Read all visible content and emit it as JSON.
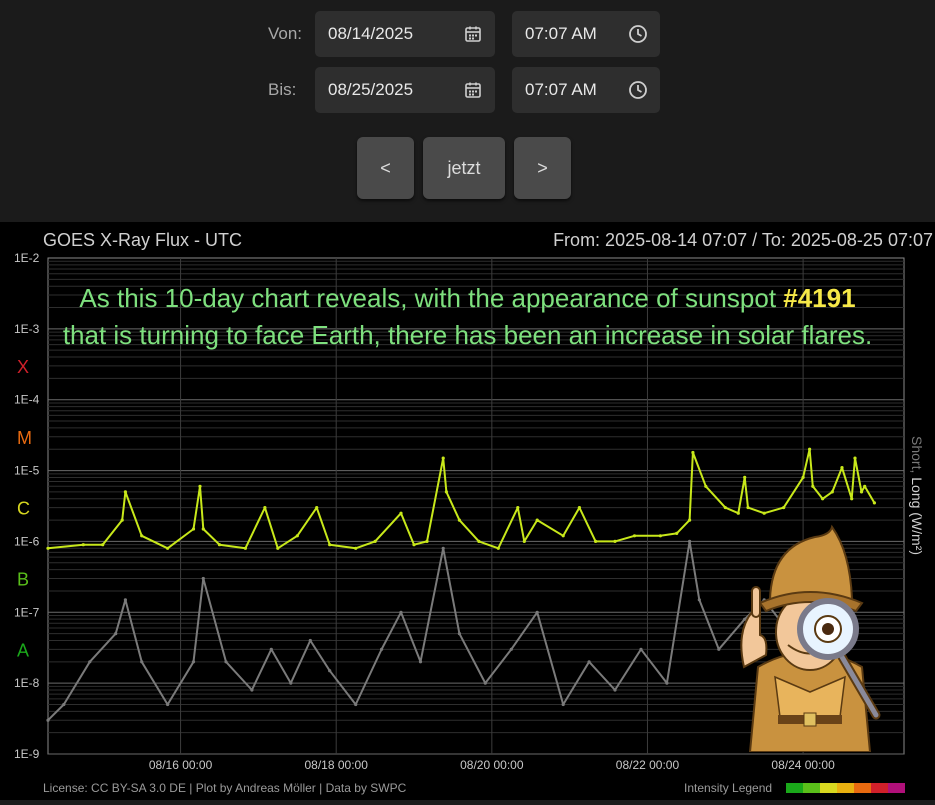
{
  "controls": {
    "from_label": "Von:",
    "from_date": "08/14/2025",
    "from_time": "07:07 AM",
    "to_label": "Bis:",
    "to_date": "08/25/2025",
    "to_time": "07:07 AM",
    "prev_label": "<",
    "now_label": "jetzt",
    "next_label": ">"
  },
  "overlay": {
    "text_before": "As this 10-day chart reveals, with the appearance of sunspot ",
    "highlight": "#4191",
    "text_after": " that is turning to face Earth, there has been an increase in solar flares."
  },
  "colors": {
    "long_series": "#c8e81a",
    "short_series": "#7a7a7a",
    "class_x": "#d0202a",
    "class_m": "#e86a10",
    "class_c": "#d8d820",
    "class_b": "#5abf1a",
    "class_a": "#1aa81a"
  },
  "chart_data": {
    "type": "line",
    "title": "GOES X-Ray Flux - UTC",
    "range_text": "From: 2025-08-14 07:07  /  To: 2025-08-25 07:07",
    "ylabel_short": "Short",
    "ylabel_sep": ", ",
    "ylabel_long": "Long (W/m²)",
    "yscale": "log",
    "ylim": [
      1e-09,
      0.01
    ],
    "xlim": [
      "2025-08-14 07:07",
      "2025-08-25 07:07"
    ],
    "x_ticks": [
      {
        "t": "2025-08-16 00:00",
        "label": "08/16 00:00"
      },
      {
        "t": "2025-08-18 00:00",
        "label": "08/18 00:00"
      },
      {
        "t": "2025-08-20 00:00",
        "label": "08/20 00:00"
      },
      {
        "t": "2025-08-22 00:00",
        "label": "08/22 00:00"
      },
      {
        "t": "2025-08-24 00:00",
        "label": "08/24 00:00"
      }
    ],
    "y_ticks": [
      {
        "v": 0.01,
        "label": "1E-2"
      },
      {
        "v": 0.001,
        "label": "1E-3"
      },
      {
        "v": 0.0001,
        "label": "1E-4"
      },
      {
        "v": 1e-05,
        "label": "1E-5"
      },
      {
        "v": 1e-06,
        "label": "1E-6"
      },
      {
        "v": 1e-07,
        "label": "1E-7"
      },
      {
        "v": 1e-08,
        "label": "1E-8"
      },
      {
        "v": 1e-09,
        "label": "1E-9"
      }
    ],
    "flare_classes": [
      {
        "label": "X",
        "v": 0.0003,
        "color": "#d0202a"
      },
      {
        "label": "M",
        "v": 3e-05,
        "color": "#e86a10"
      },
      {
        "label": "C",
        "v": 3e-06,
        "color": "#d8d820"
      },
      {
        "label": "B",
        "v": 3e-07,
        "color": "#5abf1a"
      },
      {
        "label": "A",
        "v": 3e-08,
        "color": "#1aa81a"
      }
    ],
    "grid": true,
    "series": [
      {
        "name": "Long",
        "x": [
          "2025-08-14 07:07",
          "2025-08-14 18:00",
          "2025-08-15 00:00",
          "2025-08-15 06:00",
          "2025-08-15 07:00",
          "2025-08-15 12:00",
          "2025-08-15 20:00",
          "2025-08-16 04:00",
          "2025-08-16 06:00",
          "2025-08-16 07:00",
          "2025-08-16 12:00",
          "2025-08-16 20:00",
          "2025-08-17 02:00",
          "2025-08-17 06:00",
          "2025-08-17 12:00",
          "2025-08-17 18:00",
          "2025-08-17 22:00",
          "2025-08-18 06:00",
          "2025-08-18 12:00",
          "2025-08-18 20:00",
          "2025-08-19 00:00",
          "2025-08-19 04:00",
          "2025-08-19 09:00",
          "2025-08-19 10:00",
          "2025-08-19 14:00",
          "2025-08-19 20:00",
          "2025-08-20 02:00",
          "2025-08-20 08:00",
          "2025-08-20 10:00",
          "2025-08-20 14:00",
          "2025-08-20 22:00",
          "2025-08-21 03:00",
          "2025-08-21 08:00",
          "2025-08-21 14:00",
          "2025-08-21 20:00",
          "2025-08-22 04:00",
          "2025-08-22 09:00",
          "2025-08-22 13:00",
          "2025-08-22 14:00",
          "2025-08-22 18:00",
          "2025-08-23 00:00",
          "2025-08-23 04:00",
          "2025-08-23 06:00",
          "2025-08-23 07:00",
          "2025-08-23 12:00",
          "2025-08-23 18:00",
          "2025-08-24 00:00",
          "2025-08-24 02:00",
          "2025-08-24 03:00",
          "2025-08-24 06:00",
          "2025-08-24 09:00",
          "2025-08-24 12:00",
          "2025-08-24 15:00",
          "2025-08-24 16:00",
          "2025-08-24 18:00",
          "2025-08-24 19:00",
          "2025-08-24 22:00"
        ],
        "y": [
          8e-07,
          9e-07,
          9e-07,
          2e-06,
          5e-06,
          1.2e-06,
          8e-07,
          1.5e-06,
          6e-06,
          1.5e-06,
          9e-07,
          8e-07,
          3e-06,
          8e-07,
          1.2e-06,
          3e-06,
          9e-07,
          8e-07,
          1e-06,
          2.5e-06,
          9e-07,
          1e-06,
          1.5e-05,
          5e-06,
          2e-06,
          1e-06,
          8e-07,
          3e-06,
          1e-06,
          2e-06,
          1.2e-06,
          3e-06,
          1e-06,
          1e-06,
          1.2e-06,
          1.2e-06,
          1.3e-06,
          2e-06,
          1.8e-05,
          6e-06,
          3e-06,
          2.5e-06,
          8e-06,
          3e-06,
          2.5e-06,
          3e-06,
          8e-06,
          2e-05,
          6e-06,
          4e-06,
          5e-06,
          1.1e-05,
          4e-06,
          1.5e-05,
          5e-06,
          6e-06,
          3.5e-06
        ]
      },
      {
        "name": "Short",
        "x": [
          "2025-08-14 07:07",
          "2025-08-14 12:00",
          "2025-08-14 20:00",
          "2025-08-15 04:00",
          "2025-08-15 07:00",
          "2025-08-15 12:00",
          "2025-08-15 20:00",
          "2025-08-16 04:00",
          "2025-08-16 07:00",
          "2025-08-16 14:00",
          "2025-08-16 22:00",
          "2025-08-17 04:00",
          "2025-08-17 10:00",
          "2025-08-17 16:00",
          "2025-08-17 22:00",
          "2025-08-18 06:00",
          "2025-08-18 14:00",
          "2025-08-18 20:00",
          "2025-08-19 02:00",
          "2025-08-19 09:00",
          "2025-08-19 14:00",
          "2025-08-19 22:00",
          "2025-08-20 06:00",
          "2025-08-20 14:00",
          "2025-08-20 22:00",
          "2025-08-21 06:00",
          "2025-08-21 14:00",
          "2025-08-21 22:00",
          "2025-08-22 06:00",
          "2025-08-22 13:00",
          "2025-08-22 16:00",
          "2025-08-22 22:00",
          "2025-08-23 06:00",
          "2025-08-23 12:00",
          "2025-08-23 20:00",
          "2025-08-24 04:00"
        ],
        "y": [
          3e-09,
          5e-09,
          2e-08,
          5e-08,
          1.5e-07,
          2e-08,
          5e-09,
          2e-08,
          3e-07,
          2e-08,
          8e-09,
          3e-08,
          1e-08,
          4e-08,
          1.5e-08,
          5e-09,
          3e-08,
          1e-07,
          2e-08,
          8e-07,
          5e-08,
          1e-08,
          3e-08,
          1e-07,
          5e-09,
          2e-08,
          8e-09,
          3e-08,
          1e-08,
          1e-06,
          1.5e-07,
          3e-08,
          8e-08,
          1.5e-07,
          5e-08,
          1e-07
        ]
      }
    ],
    "footer_left": "License: CC BY-SA 3.0 DE | Plot by Andreas Möller | Data by SWPC",
    "footer_right": "Intensity Legend"
  }
}
